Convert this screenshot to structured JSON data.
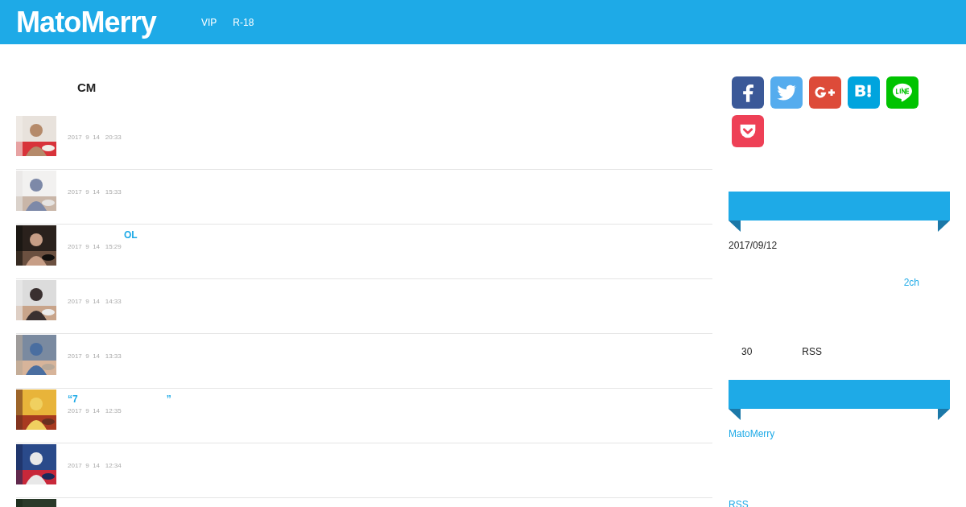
{
  "header": {
    "logo": "MatoMerry",
    "nav": [
      "VIP",
      "R-18"
    ]
  },
  "main": {
    "heading": "CM",
    "posts": [
      {
        "thumbnail": {
          "kind": "picture"
        },
        "date": "2017  9  14   20:33"
      },
      {
        "thumbnail": {
          "kind": "picture"
        },
        "date": "2017  9  14   15:33"
      },
      {
        "thumbnail": {
          "kind": "picture"
        },
        "title_parts": [
          "OL"
        ],
        "date": "2017  9  14   15:29"
      },
      {
        "thumbnail": {
          "kind": "picture"
        },
        "date": "2017  9  14   14:33"
      },
      {
        "thumbnail": {
          "kind": "picture"
        },
        "date": "2017  9  14   13:33"
      },
      {
        "thumbnail": {
          "kind": "picture"
        },
        "title_parts": [
          "“7",
          "”"
        ],
        "date": "2017  9  14   12:35"
      },
      {
        "thumbnail": {
          "kind": "picture"
        },
        "date": "2017  9  14   12:34"
      },
      {
        "thumbnail": {
          "kind": "picture"
        }
      }
    ]
  },
  "sidebar": {
    "share": [
      {
        "kind": "facebook"
      },
      {
        "kind": "twitter"
      },
      {
        "kind": "googleplus"
      },
      {
        "kind": "hatena"
      },
      {
        "kind": "line"
      },
      {
        "kind": "pocket"
      }
    ],
    "widgets": [
      {
        "date": "2017/09/12",
        "link": "2ch",
        "count": "30",
        "rss": "RSS"
      },
      {
        "links": [
          "MatoMerry",
          "RSS"
        ]
      }
    ]
  }
}
